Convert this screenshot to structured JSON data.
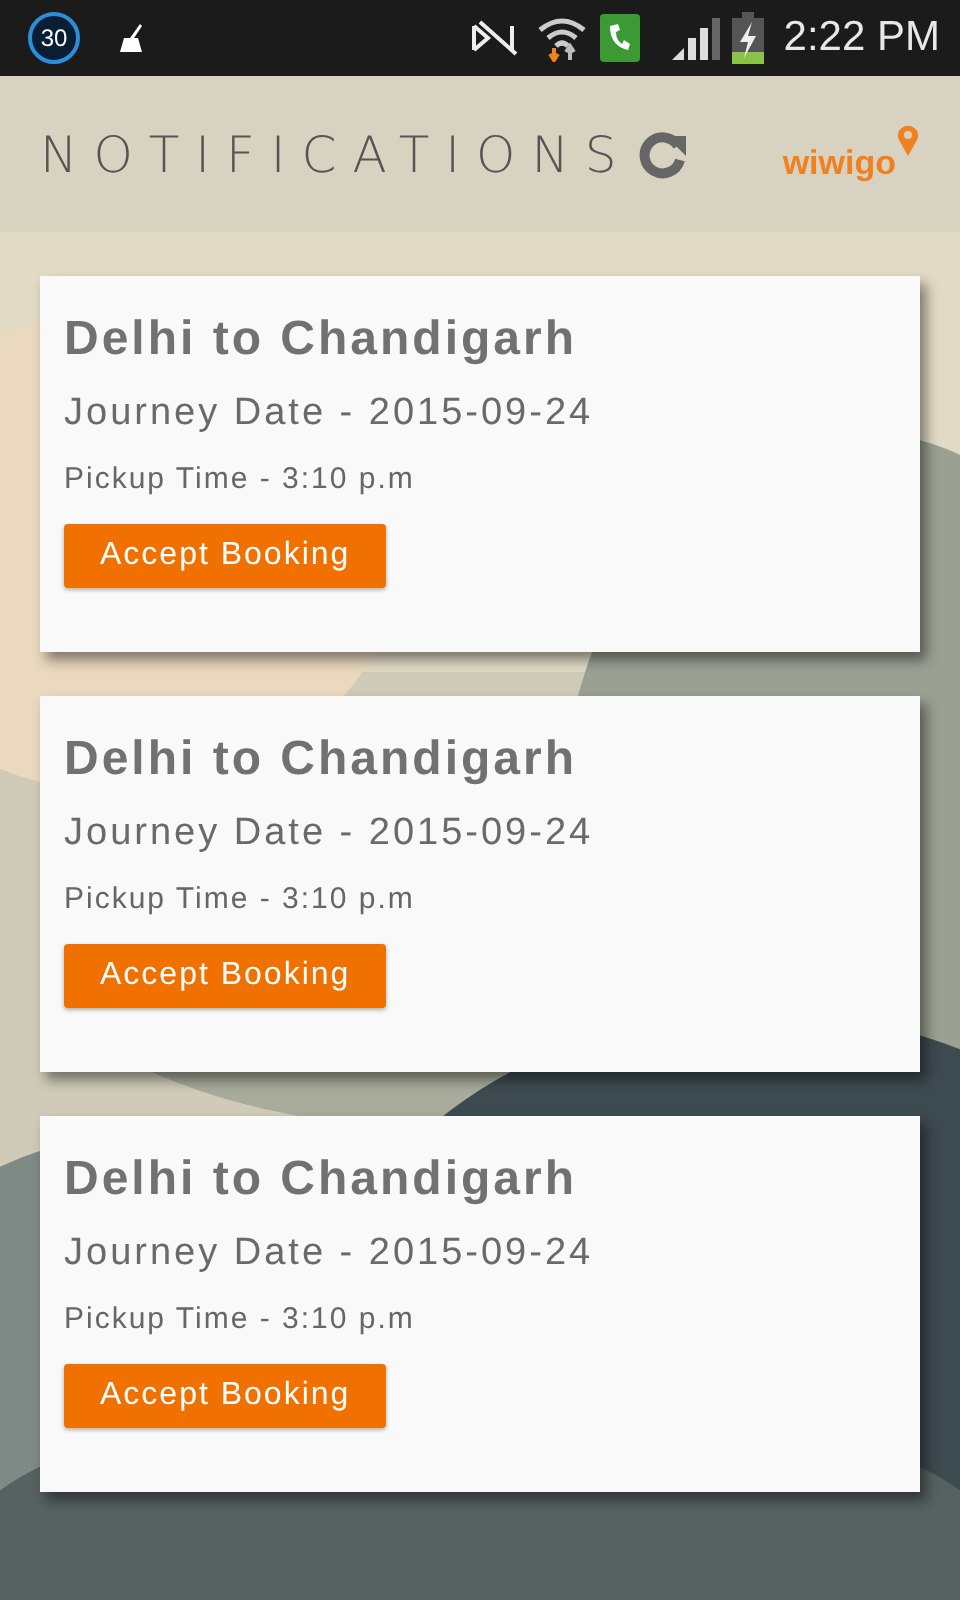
{
  "status_bar": {
    "badge": "30",
    "time": "2:22 PM"
  },
  "header": {
    "title": "NOTIFICATIONS",
    "logo": "wiwigo"
  },
  "bookings": [
    {
      "route": "Delhi to Chandigarh",
      "journey_date": "Journey Date - 2015-09-24",
      "pickup_time": "Pickup Time - 3:10 p.m",
      "button": "Accept Booking"
    },
    {
      "route": "Delhi to Chandigarh",
      "journey_date": "Journey Date - 2015-09-24",
      "pickup_time": "Pickup Time - 3:10 p.m",
      "button": "Accept Booking"
    },
    {
      "route": "Delhi to Chandigarh",
      "journey_date": "Journey Date - 2015-09-24",
      "pickup_time": "Pickup Time - 3:10 p.m",
      "button": "Accept Booking"
    }
  ]
}
